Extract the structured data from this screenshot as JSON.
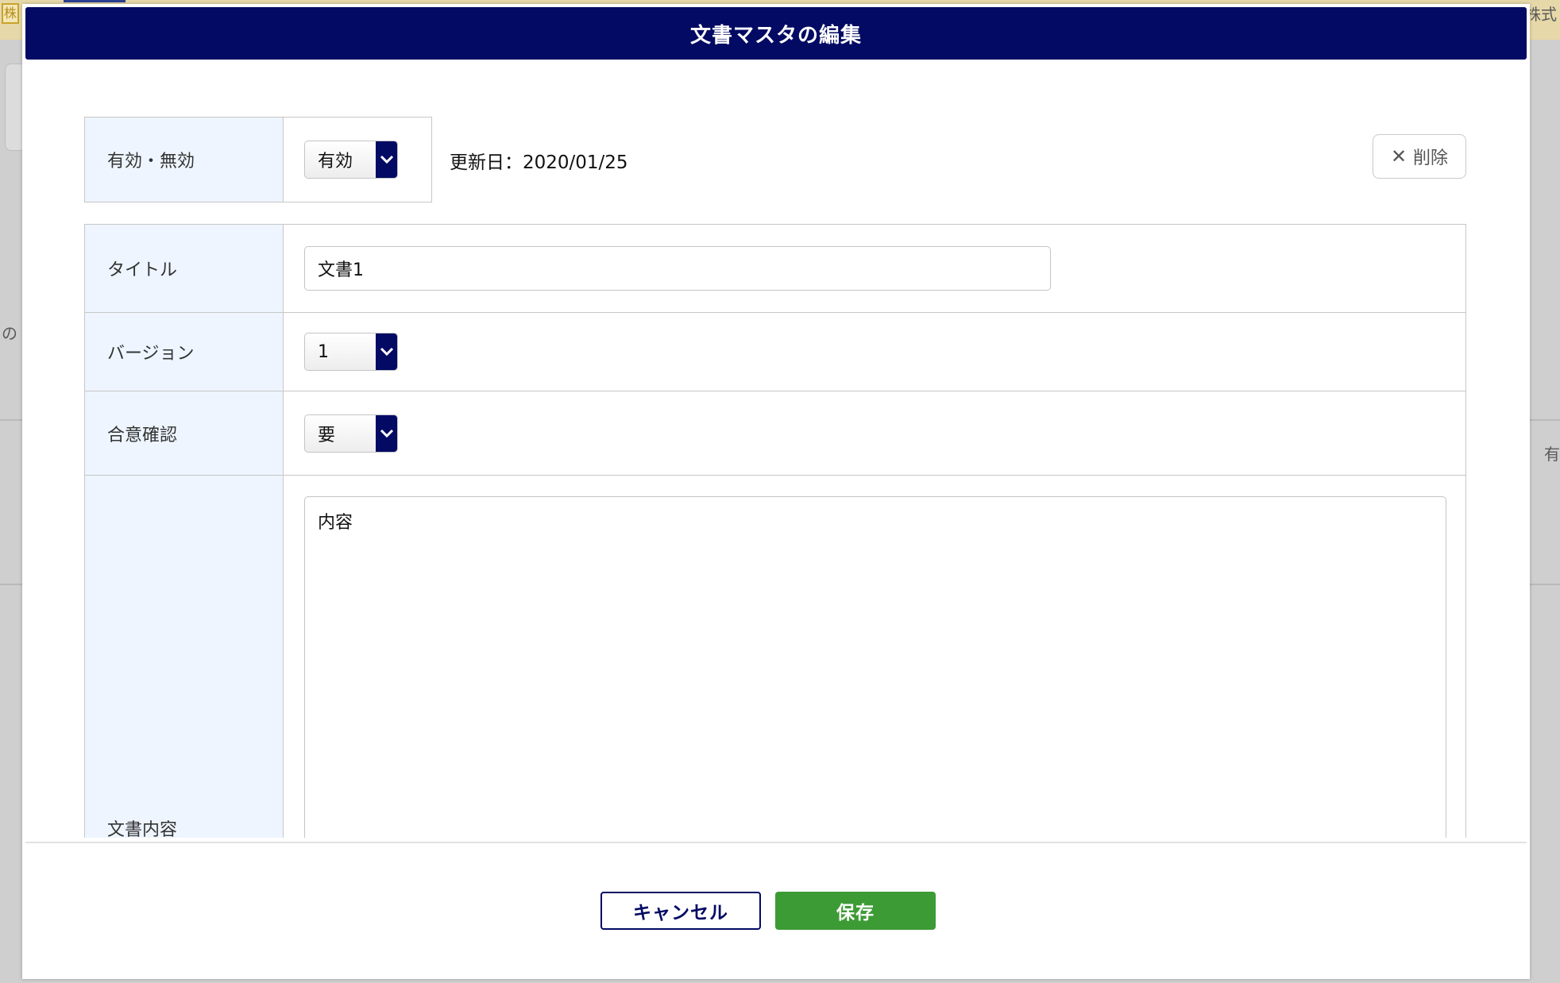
{
  "background": {
    "badge": "株",
    "top_right_text": "株式",
    "left_text": "の",
    "right_text": "有"
  },
  "modal": {
    "title": "文書マスタの編集",
    "status": {
      "label": "有効・無効",
      "value": "有効"
    },
    "updated_date": "更新日：2020/01/25",
    "delete_label": "削除",
    "form": {
      "title_label": "タイトル",
      "title_value": "文書1",
      "version_label": "バージョン",
      "version_value": "1",
      "consent_label": "合意確認",
      "consent_value": "要",
      "content_label": "文書内容",
      "content_value": "内容"
    },
    "cancel_label": "キャンセル",
    "save_label": "保存"
  },
  "colors": {
    "header": "#020a63",
    "label_bg": "#eef5ff",
    "save": "#3d9b35"
  }
}
